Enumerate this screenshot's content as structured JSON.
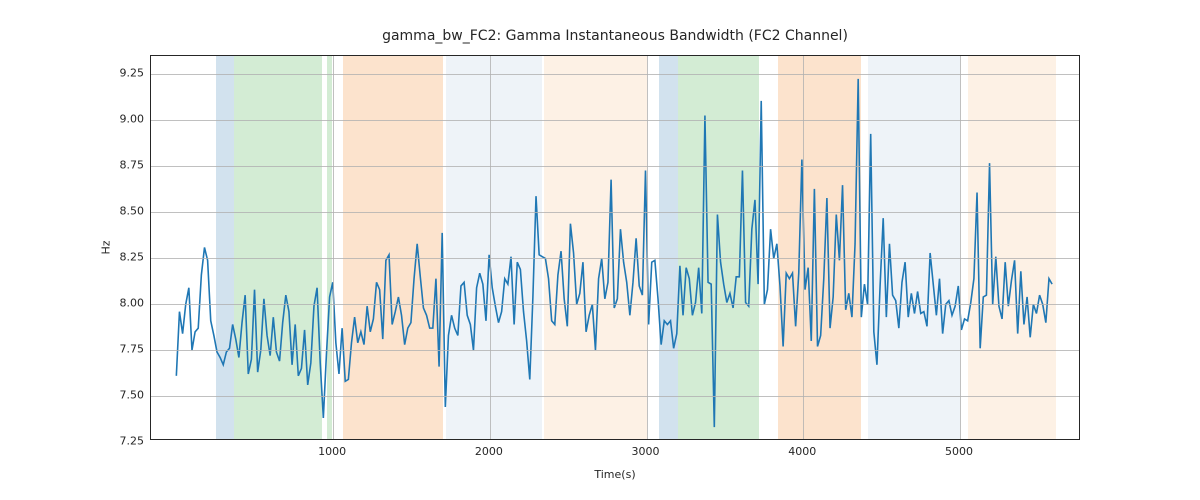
{
  "chart_data": {
    "type": "line",
    "title": "gamma_bw_FC2: Gamma Instantaneous Bandwidth (FC2 Channel)",
    "xlabel": "Time(s)",
    "ylabel": "Hz",
    "xlim": [
      -162,
      5772
    ],
    "ylim": [
      7.255,
      9.345
    ],
    "xticks": [
      1000,
      2000,
      3000,
      4000,
      5000
    ],
    "yticks": [
      7.25,
      7.5,
      7.75,
      8.0,
      8.25,
      8.5,
      8.75,
      9.0,
      9.25
    ],
    "xtick_labels": [
      "1000",
      "2000",
      "3000",
      "4000",
      "5000"
    ],
    "ytick_labels": [
      "7.25",
      "7.50",
      "7.75",
      "8.00",
      "8.25",
      "8.50",
      "8.75",
      "9.00",
      "9.25"
    ],
    "line_color": "#1f77b4",
    "spans": [
      {
        "x0": 250,
        "x1": 370,
        "color": "#6a9fc7"
      },
      {
        "x0": 370,
        "x1": 930,
        "color": "#6dbf72"
      },
      {
        "x0": 960,
        "x1": 990,
        "color": "#6dbf72"
      },
      {
        "x0": 1060,
        "x1": 1700,
        "color": "#f5a35b"
      },
      {
        "x0": 1720,
        "x1": 2330,
        "color": "#c7d7e8"
      },
      {
        "x0": 2345,
        "x1": 3005,
        "color": "#f8d2a8"
      },
      {
        "x0": 3080,
        "x1": 3200,
        "color": "#6a9fc7"
      },
      {
        "x0": 3200,
        "x1": 3720,
        "color": "#6dbf72"
      },
      {
        "x0": 3840,
        "x1": 4370,
        "color": "#f5a35b"
      },
      {
        "x0": 4410,
        "x1": 5000,
        "color": "#c7d7e8"
      },
      {
        "x0": 5050,
        "x1": 5610,
        "color": "#f8d2a8"
      }
    ],
    "x": [
      0,
      20,
      40,
      60,
      80,
      100,
      120,
      140,
      160,
      180,
      200,
      220,
      240,
      260,
      280,
      300,
      320,
      340,
      360,
      380,
      400,
      420,
      440,
      460,
      480,
      500,
      520,
      540,
      560,
      580,
      600,
      620,
      640,
      660,
      680,
      700,
      720,
      740,
      760,
      780,
      800,
      820,
      840,
      860,
      880,
      900,
      920,
      940,
      960,
      980,
      1000,
      1020,
      1040,
      1060,
      1080,
      1100,
      1120,
      1140,
      1160,
      1180,
      1200,
      1220,
      1240,
      1260,
      1280,
      1300,
      1320,
      1340,
      1360,
      1380,
      1400,
      1420,
      1440,
      1460,
      1480,
      1500,
      1520,
      1540,
      1560,
      1580,
      1600,
      1620,
      1640,
      1660,
      1680,
      1700,
      1720,
      1740,
      1760,
      1780,
      1800,
      1820,
      1840,
      1860,
      1880,
      1900,
      1920,
      1940,
      1960,
      1980,
      2000,
      2020,
      2040,
      2060,
      2080,
      2100,
      2120,
      2140,
      2160,
      2180,
      2200,
      2220,
      2240,
      2260,
      2280,
      2300,
      2320,
      2340,
      2360,
      2380,
      2400,
      2420,
      2440,
      2460,
      2480,
      2500,
      2520,
      2540,
      2560,
      2580,
      2600,
      2620,
      2640,
      2660,
      2680,
      2700,
      2720,
      2740,
      2760,
      2780,
      2800,
      2820,
      2840,
      2860,
      2880,
      2900,
      2920,
      2940,
      2960,
      2980,
      3000,
      3020,
      3040,
      3060,
      3080,
      3100,
      3120,
      3140,
      3160,
      3180,
      3200,
      3220,
      3240,
      3260,
      3280,
      3300,
      3320,
      3340,
      3360,
      3380,
      3400,
      3420,
      3440,
      3460,
      3480,
      3500,
      3520,
      3540,
      3560,
      3580,
      3600,
      3620,
      3640,
      3660,
      3680,
      3700,
      3720,
      3740,
      3760,
      3780,
      3800,
      3820,
      3840,
      3860,
      3880,
      3900,
      3920,
      3940,
      3960,
      3980,
      4000,
      4020,
      4040,
      4060,
      4080,
      4100,
      4120,
      4140,
      4160,
      4180,
      4200,
      4220,
      4240,
      4260,
      4280,
      4300,
      4320,
      4340,
      4360,
      4380,
      4400,
      4420,
      4440,
      4460,
      4480,
      4500,
      4520,
      4540,
      4560,
      4580,
      4600,
      4620,
      4640,
      4660,
      4680,
      4700,
      4720,
      4740,
      4760,
      4780,
      4800,
      4820,
      4840,
      4860,
      4880,
      4900,
      4920,
      4940,
      4960,
      4980,
      5000,
      5020,
      5040,
      5060,
      5080,
      5100,
      5120,
      5140,
      5160,
      5180,
      5200,
      5220,
      5240,
      5260,
      5280,
      5300,
      5320,
      5340,
      5360,
      5380,
      5400,
      5420,
      5440,
      5460,
      5480,
      5500,
      5520,
      5540,
      5560,
      5580,
      5600
    ],
    "y": [
      7.6,
      7.95,
      7.83,
      7.99,
      8.08,
      7.74,
      7.84,
      7.86,
      8.15,
      8.3,
      8.23,
      7.9,
      7.82,
      7.73,
      7.7,
      7.66,
      7.73,
      7.75,
      7.88,
      7.8,
      7.7,
      7.89,
      8.04,
      7.61,
      7.69,
      8.07,
      7.62,
      7.74,
      8.02,
      7.82,
      7.71,
      7.92,
      7.73,
      7.68,
      7.89,
      8.04,
      7.95,
      7.66,
      7.88,
      7.6,
      7.64,
      7.85,
      7.55,
      7.67,
      7.98,
      8.08,
      7.67,
      7.37,
      7.72,
      8.03,
      8.11,
      7.78,
      7.61,
      7.86,
      7.57,
      7.58,
      7.78,
      7.92,
      7.78,
      7.84,
      7.77,
      7.98,
      7.84,
      7.91,
      8.11,
      8.07,
      7.8,
      8.23,
      8.26,
      7.88,
      7.95,
      8.03,
      7.93,
      7.77,
      7.86,
      7.89,
      8.13,
      8.32,
      8.14,
      7.97,
      7.93,
      7.86,
      7.86,
      8.13,
      7.65,
      8.38,
      7.43,
      7.82,
      7.93,
      7.86,
      7.82,
      8.09,
      8.11,
      7.93,
      7.88,
      7.74,
      8.08,
      8.16,
      8.1,
      7.9,
      8.26,
      8.08,
      7.98,
      7.89,
      7.95,
      8.13,
      8.1,
      8.25,
      7.88,
      8.22,
      8.18,
      7.95,
      7.79,
      7.58,
      8.03,
      8.58,
      8.26,
      8.25,
      8.24,
      8.13,
      7.9,
      7.88,
      8.15,
      8.28,
      8.02,
      7.87,
      8.43,
      8.27,
      7.99,
      8.05,
      8.22,
      7.84,
      7.93,
      7.99,
      7.74,
      8.13,
      8.24,
      8.02,
      8.11,
      8.67,
      7.97,
      8.02,
      8.4,
      8.22,
      8.11,
      7.93,
      8.11,
      8.35,
      8.09,
      8.04,
      8.72,
      7.88,
      8.22,
      8.23,
      8.02,
      7.77,
      7.9,
      7.88,
      7.9,
      7.75,
      7.83,
      8.2,
      7.93,
      8.19,
      8.13,
      7.93,
      8.0,
      8.19,
      7.94,
      9.02,
      8.11,
      8.1,
      7.32,
      8.48,
      8.22,
      8.1,
      8.0,
      8.05,
      7.97,
      8.14,
      8.14,
      8.72,
      8.0,
      7.98,
      8.4,
      8.56,
      8.1,
      9.1,
      7.99,
      8.07,
      8.4,
      8.24,
      8.32,
      8.09,
      7.76,
      8.16,
      8.13,
      8.16,
      7.87,
      8.16,
      8.78,
      8.07,
      8.19,
      7.79,
      8.62,
      7.76,
      7.82,
      8.13,
      8.57,
      7.86,
      8.03,
      8.48,
      8.23,
      8.64,
      7.96,
      8.05,
      7.92,
      8.32,
      9.22,
      7.92,
      8.1,
      7.99,
      8.92,
      7.84,
      7.66,
      8.09,
      8.46,
      7.92,
      8.32,
      8.04,
      8.01,
      7.86,
      8.11,
      8.22,
      7.92,
      8.05,
      7.94,
      8.06,
      7.94,
      7.95,
      7.87,
      8.27,
      8.1,
      7.93,
      8.13,
      7.83,
      7.99,
      8.01,
      7.93,
      7.98,
      8.09,
      7.85,
      7.91,
      7.9,
      8.0,
      8.13,
      8.6,
      7.75,
      8.03,
      8.04,
      8.76,
      7.99,
      8.25,
      7.98,
      7.91,
      8.22,
      7.98,
      8.12,
      8.23,
      7.83,
      8.17,
      7.88,
      8.03,
      7.81,
      7.99,
      7.94,
      8.04,
      7.99,
      7.89,
      8.13,
      8.1
    ]
  }
}
